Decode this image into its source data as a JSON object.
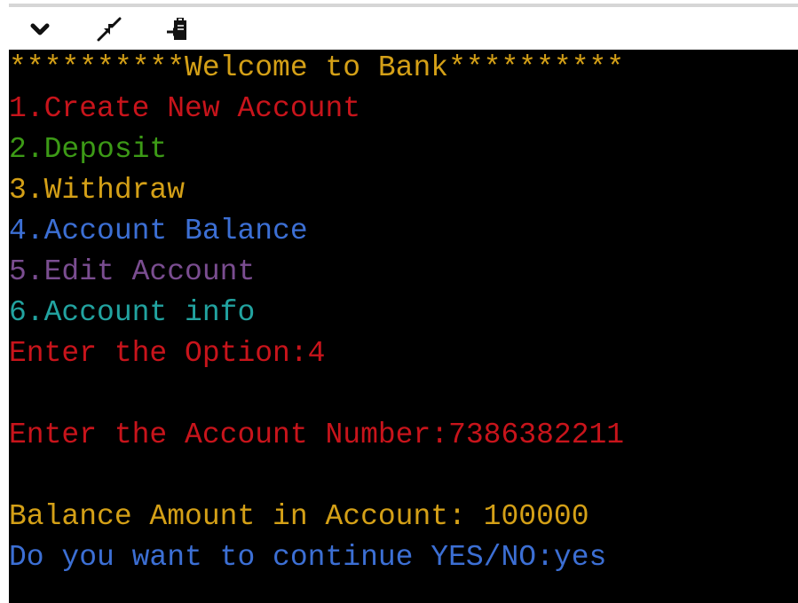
{
  "toolbar": {
    "icons": [
      "chevron-down-icon",
      "collapse-arrows-icon",
      "clipboard-paste-icon"
    ]
  },
  "console": {
    "lines": [
      {
        "text": "**********Welcome to Bank**********",
        "color": "#d4a017"
      },
      {
        "text": "1.Create New Account",
        "color": "#c8141b"
      },
      {
        "text": "2.Deposit",
        "color": "#3c9a16"
      },
      {
        "text": "3.Withdraw",
        "color": "#d4a017"
      },
      {
        "text": "4.Account Balance",
        "color": "#3c6fd4"
      },
      {
        "text": "5.Edit Account",
        "color": "#7a4d90"
      },
      {
        "text": "6.Account info",
        "color": "#22a3a0"
      },
      {
        "text": "Enter the Option:4",
        "color": "#c8141b"
      },
      {
        "text": "",
        "color": "#c8141b"
      },
      {
        "text": "Enter the Account Number:7386382211",
        "color": "#c8141b"
      },
      {
        "text": "",
        "color": "#d4a017"
      },
      {
        "text": "Balance Amount in Account: 100000",
        "color": "#d4a017"
      },
      {
        "text": "Do you want to continue YES/NO:yes",
        "color": "#3c6fd4"
      }
    ]
  }
}
